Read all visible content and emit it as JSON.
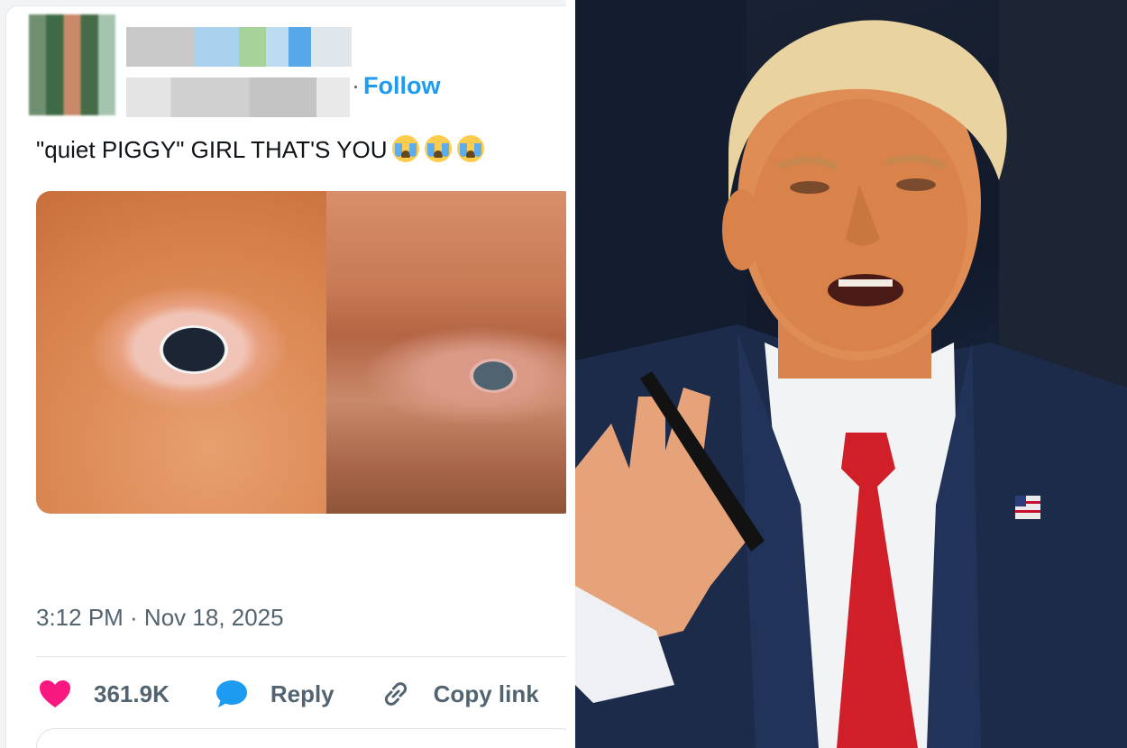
{
  "tweet": {
    "follow_label": "Follow",
    "follow_separator": "·",
    "text": "\"quiet PIGGY\" GIRL THAT'S YOU",
    "emojis": [
      "loudly-crying-face",
      "loudly-crying-face",
      "loudly-crying-face"
    ],
    "timestamp": "3:12 PM · Nov 18, 2025",
    "actions": {
      "like_count": "361.9K",
      "reply_label": "Reply",
      "copy_link_label": "Copy link"
    },
    "colors": {
      "link": "#1d9bf0",
      "like": "#f91880",
      "reply_bubble": "#1d9bf0"
    }
  }
}
